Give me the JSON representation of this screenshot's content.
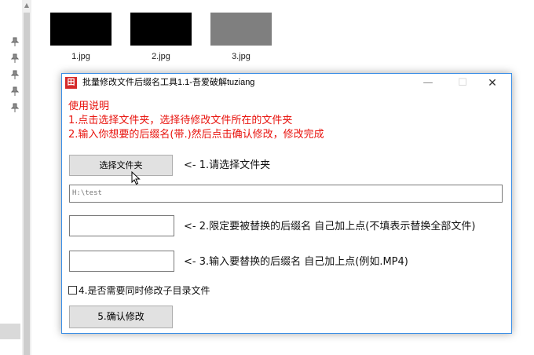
{
  "explorer": {
    "files": [
      {
        "name": "1.jpg",
        "color": "#000000"
      },
      {
        "name": "2.jpg",
        "color": "#000000"
      },
      {
        "name": "3.jpg",
        "color": "#7f7f7f"
      }
    ],
    "pin_icon": "pin-icon",
    "scroll_up_glyph": "▲"
  },
  "window": {
    "title": "批量修改文件后缀名工具1.1-吾爱破解tuziang",
    "icon": "app-icon",
    "icon_glyph": "田",
    "min_glyph": "—",
    "max_glyph": "☐",
    "close_glyph": "✕",
    "accent_color": "#3a8ee6"
  },
  "instructions": {
    "heading": "使用说明",
    "line1": "1.点击选择文件夹，选择待修改文件所在的文件夹",
    "line2": "2.输入你想要的后缀名(带.)然后点击确认修改，修改完成",
    "color": "#e8120c"
  },
  "step1": {
    "button_label": "选择文件夹",
    "hint": "<- 1.请选择文件夹"
  },
  "path_field": {
    "value": "H:\\test"
  },
  "step2": {
    "value": "",
    "hint": "<- 2.限定要被替换的后缀名 自己加上点(不填表示替换全部文件)"
  },
  "step3": {
    "value": "",
    "hint": "<- 3.输入要替换的后缀名 自己加上点(例如.MP4)"
  },
  "step4": {
    "checked": false,
    "label": "4.是否需要同时修改子目录文件"
  },
  "step5": {
    "button_label": "5.确认修改"
  }
}
